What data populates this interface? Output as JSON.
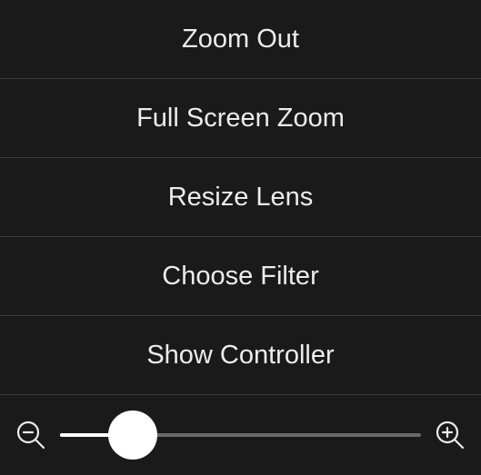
{
  "menu": {
    "items": [
      {
        "label": "Zoom Out"
      },
      {
        "label": "Full Screen Zoom"
      },
      {
        "label": "Resize Lens"
      },
      {
        "label": "Choose Filter"
      },
      {
        "label": "Show Controller"
      }
    ]
  },
  "slider": {
    "value": 15,
    "min": 0,
    "max": 100
  },
  "icons": {
    "zoom_out": "magnifying-glass-minus",
    "zoom_in": "magnifying-glass-plus"
  }
}
